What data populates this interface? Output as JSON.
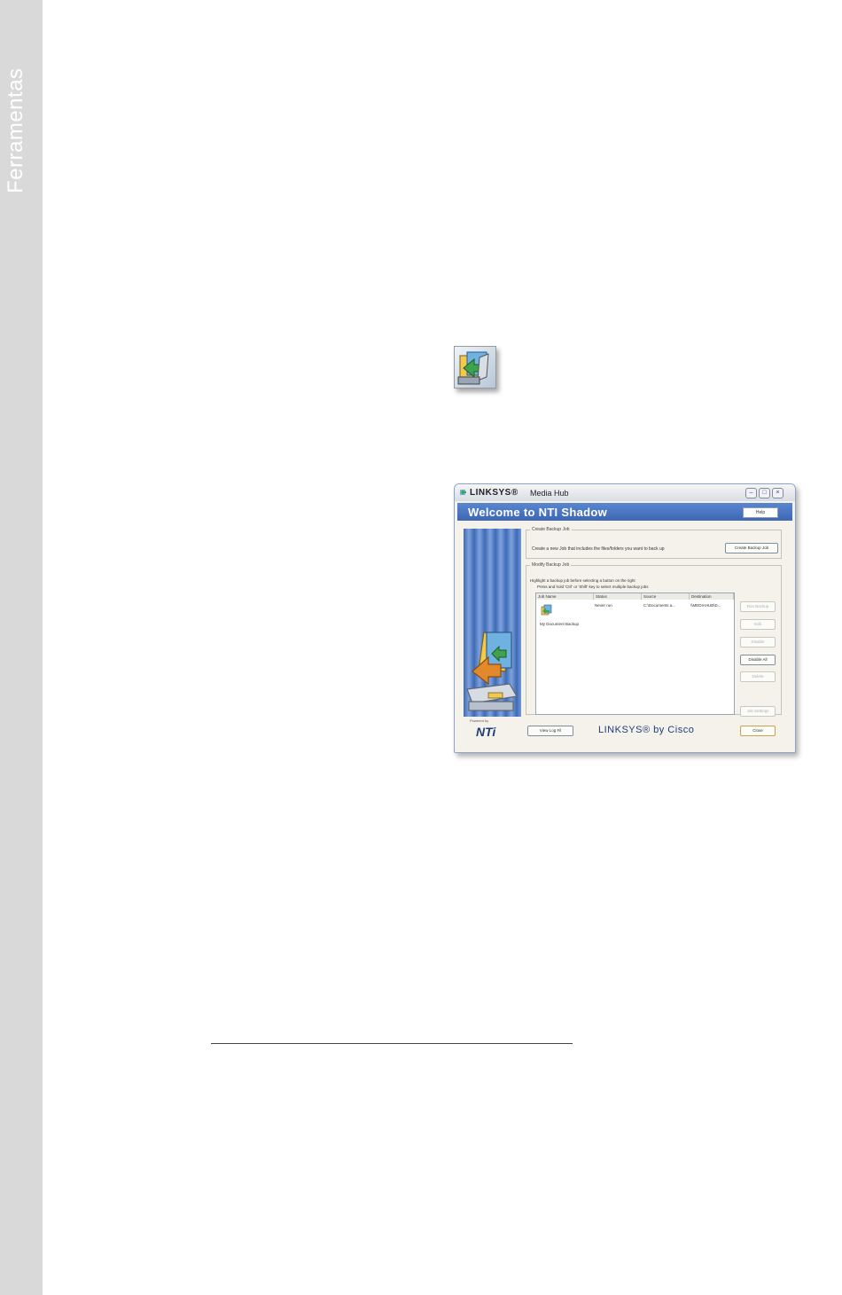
{
  "sidebar": {
    "title": "Ferramentas"
  },
  "window": {
    "brand": "LINKSYS®",
    "app_name": "Media Hub",
    "banner_title": "Welcome to NTI Shadow",
    "help_label": "Help",
    "create_section": {
      "legend": "Create Backup Job",
      "description": "Create a new Job that includes the files/folders you want to back up",
      "button": "Create Backup Job"
    },
    "modify_section": {
      "legend": "Modify Backup Job",
      "hint": "Highlight a backup job before selecting a button on the right",
      "hint2": "Press and hold 'Ctrl' or 'Shift' key to select multiple backup jobs",
      "columns": [
        "Job Name",
        "Status",
        "Source",
        "Destination"
      ],
      "job": {
        "name": "My Document Backup",
        "status": "Never run",
        "source": "C:\\Documents a...",
        "destination": "\\\\MEDIAHUB\\D..."
      },
      "buttons": [
        "Run Backup",
        "Edit",
        "Disable",
        "Disable All",
        "Delete",
        "Job Settings"
      ]
    },
    "powered_by": "Powered by",
    "nti_logo": "NTi",
    "view_log_button": "View Log Fil",
    "footer_logo": "LINKSYS® by Cisco",
    "close_button": "Close"
  }
}
